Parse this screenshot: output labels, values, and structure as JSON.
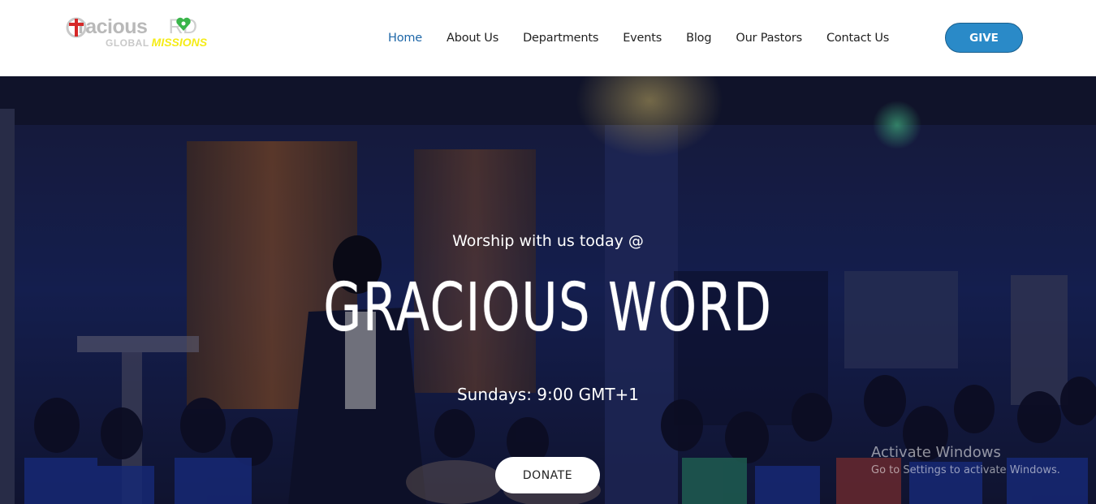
{
  "brand": {
    "logo_word": "racious",
    "logo_word_end": "RD",
    "logo_sub_1": "GLOBAL",
    "logo_sub_2": "MISSIONS"
  },
  "nav": {
    "items": [
      {
        "label": "Home",
        "active": true
      },
      {
        "label": "About Us"
      },
      {
        "label": "Departments"
      },
      {
        "label": "Events"
      },
      {
        "label": "Blog"
      },
      {
        "label": "Our Pastors"
      },
      {
        "label": "Contact Us"
      }
    ],
    "give_label": "GIVE"
  },
  "hero": {
    "subtitle": "Worship with us today @",
    "title": "GRACIOUS WORD",
    "schedule": "Sundays: 9:00 GMT+1",
    "donate_label": "DONATE"
  },
  "watermark": {
    "title": "Activate Windows",
    "subtitle": "Go to Settings to activate Windows."
  },
  "colors": {
    "accent": "#1e67a8",
    "give_button": "#2a8ac8",
    "logo_yellow": "#f5ec16",
    "logo_cross": "#d62828",
    "logo_heart": "#3ab54a"
  },
  "icons": {
    "logo_cross": "cross-icon",
    "logo_heart": "heart-icon"
  }
}
